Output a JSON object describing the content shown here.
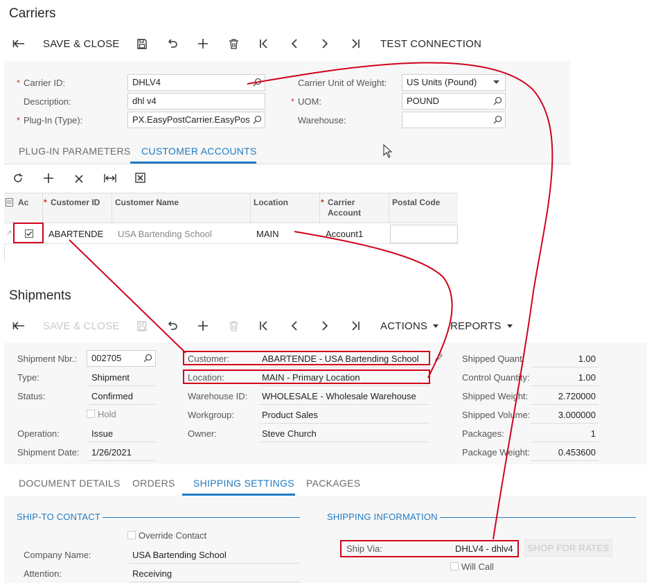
{
  "carriers": {
    "title": "Carriers",
    "toolbar": {
      "save_close": "SAVE & CLOSE",
      "test_connection": "TEST CONNECTION"
    },
    "form": {
      "carrier_id_label": "Carrier ID:",
      "carrier_id": "DHLV4",
      "description_label": "Description:",
      "description": "dhl v4",
      "plugin_label": "Plug-In (Type):",
      "plugin": "PX.EasyPostCarrier.EasyPos",
      "unit_weight_label": "Carrier Unit of Weight:",
      "unit_weight": "US Units (Pound)",
      "uom_label": "UOM:",
      "uom": "POUND",
      "warehouse_label": "Warehouse:",
      "warehouse": ""
    },
    "tabs": [
      "PLUG-IN PARAMETERS",
      "CUSTOMER ACCOUNTS"
    ],
    "grid": {
      "headers": [
        "Ac",
        "Customer ID",
        "Customer Name",
        "Location",
        "Carrier Account",
        "Postal Code"
      ],
      "row": {
        "customer_id": "ABARTENDE",
        "customer_name": "USA Bartending School",
        "location": "MAIN",
        "carrier_account": "Account1",
        "postal_code": ""
      }
    }
  },
  "shipments": {
    "title": "Shipments",
    "toolbar": {
      "save_close": "SAVE & CLOSE",
      "actions": "ACTIONS",
      "reports": "REPORTS"
    },
    "form": {
      "shipment_nbr_label": "Shipment Nbr.:",
      "shipment_nbr": "002705",
      "type_label": "Type:",
      "type": "Shipment",
      "status_label": "Status:",
      "status": "Confirmed",
      "hold_label": "Hold",
      "operation_label": "Operation:",
      "operation": "Issue",
      "date_label": "Shipment Date:",
      "date": "1/26/2021",
      "customer_label": "Customer:",
      "customer": "ABARTENDE - USA Bartending School",
      "location_label": "Location:",
      "location": "MAIN - Primary Location",
      "warehouse_label": "Warehouse ID:",
      "warehouse": "WHOLESALE - Wholesale Warehouse",
      "workgroup_label": "Workgroup:",
      "workgroup": "Product Sales",
      "owner_label": "Owner:",
      "owner": "Steve Church",
      "shipped_qty_label": "Shipped Quant.",
      "shipped_qty": "1.00",
      "control_qty_label": "Control Quantity:",
      "control_qty": "1.00",
      "shipped_weight_label": "Shipped Weight:",
      "shipped_weight": "2.720000",
      "shipped_volume_label": "Shipped Volume:",
      "shipped_volume": "3.000000",
      "packages_label": "Packages:",
      "packages": "1",
      "package_weight_label": "Package Weight:",
      "package_weight": "0.453600"
    },
    "tabs": [
      "DOCUMENT DETAILS",
      "ORDERS",
      "SHIPPING SETTINGS",
      "PACKAGES"
    ],
    "ship_to": {
      "header": "SHIP-TO CONTACT",
      "override_label": "Override Contact",
      "company_label": "Company Name:",
      "company": "USA Bartending School",
      "attention_label": "Attention:",
      "attention": "Receiving"
    },
    "shipping_info": {
      "header": "SHIPPING INFORMATION",
      "ship_via_label": "Ship Via:",
      "ship_via": "DHLV4 - dhlv4",
      "shop_rates": "SHOP FOR RATES",
      "will_call_label": "Will Call"
    }
  },
  "colors": {
    "accent": "#1f7ac2",
    "annotation": "#d0021b"
  }
}
